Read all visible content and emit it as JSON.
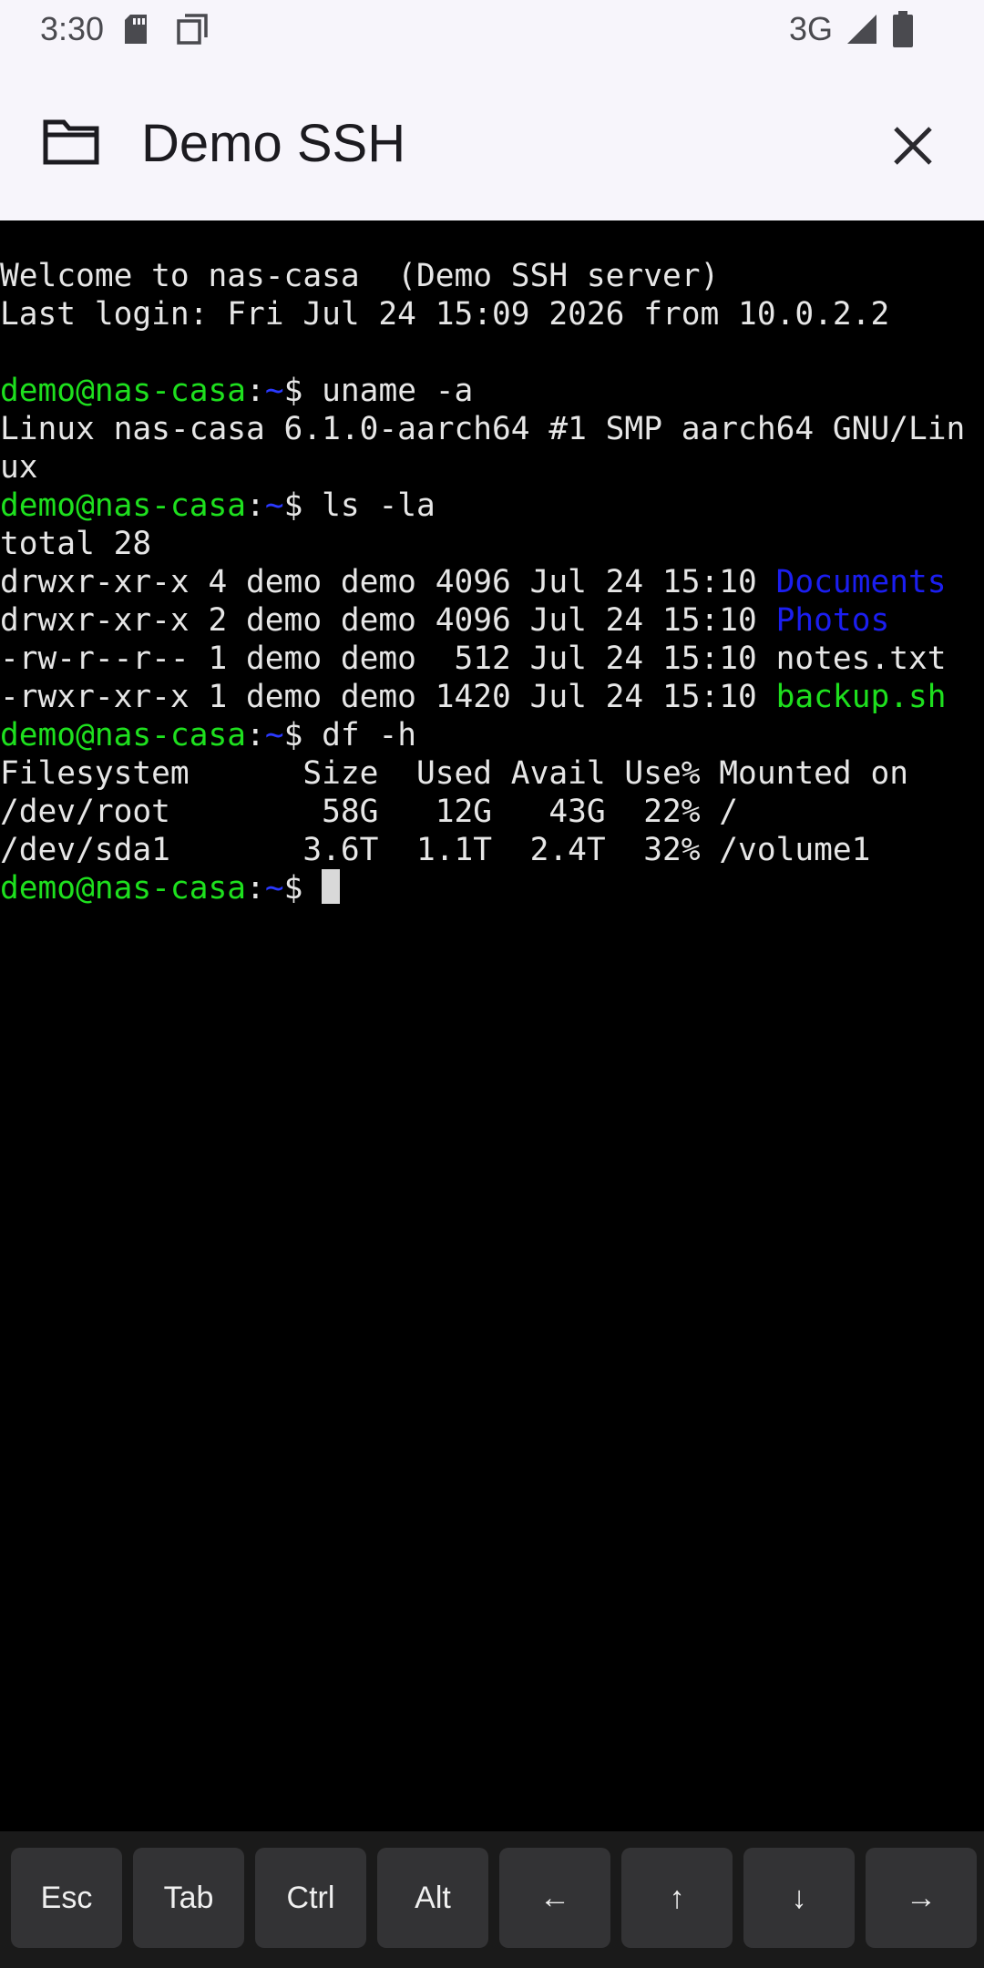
{
  "status_bar": {
    "time": "3:30",
    "network": "3G",
    "icons": [
      "sd-card-icon",
      "pages-icon",
      "signal-icon",
      "battery-icon"
    ]
  },
  "app_bar": {
    "title": "Demo SSH",
    "left_icon": "folder-icon",
    "right_icon": "close-icon"
  },
  "terminal": {
    "lines": [
      [
        {
          "t": "Welcome to nas-casa  (Demo SSH server)",
          "c": "white"
        }
      ],
      [
        {
          "t": "Last login: Fri Jul 24 15:09 2026 from 10.0.2.2",
          "c": "white"
        }
      ],
      [
        {
          "t": "",
          "c": "white"
        }
      ],
      [
        {
          "t": "demo@nas-casa",
          "c": "green"
        },
        {
          "t": ":",
          "c": "white"
        },
        {
          "t": "~",
          "c": "prompt-blue"
        },
        {
          "t": "$ uname -a",
          "c": "white"
        }
      ],
      [
        {
          "t": "Linux nas-casa 6.1.0-aarch64 #1 SMP aarch64 GNU/Lin",
          "c": "white"
        }
      ],
      [
        {
          "t": "ux",
          "c": "white"
        }
      ],
      [
        {
          "t": "demo@nas-casa",
          "c": "green"
        },
        {
          "t": ":",
          "c": "white"
        },
        {
          "t": "~",
          "c": "prompt-blue"
        },
        {
          "t": "$ ls -la",
          "c": "white"
        }
      ],
      [
        {
          "t": "total 28",
          "c": "white"
        }
      ],
      [
        {
          "t": "drwxr-xr-x 4 demo demo 4096 Jul 24 15:10 ",
          "c": "white"
        },
        {
          "t": "Documents",
          "c": "blue"
        }
      ],
      [
        {
          "t": "drwxr-xr-x 2 demo demo 4096 Jul 24 15:10 ",
          "c": "white"
        },
        {
          "t": "Photos",
          "c": "blue"
        }
      ],
      [
        {
          "t": "-rw-r--r-- 1 demo demo  512 Jul 24 15:10 notes.txt",
          "c": "white"
        }
      ],
      [
        {
          "t": "-rwxr-xr-x 1 demo demo 1420 Jul 24 15:10 ",
          "c": "white"
        },
        {
          "t": "backup.sh",
          "c": "green"
        }
      ],
      [
        {
          "t": "demo@nas-casa",
          "c": "green"
        },
        {
          "t": ":",
          "c": "white"
        },
        {
          "t": "~",
          "c": "prompt-blue"
        },
        {
          "t": "$ df -h",
          "c": "white"
        }
      ],
      [
        {
          "t": "Filesystem      Size  Used Avail Use% Mounted on",
          "c": "white"
        }
      ],
      [
        {
          "t": "/dev/root        58G   12G   43G  22% /",
          "c": "white"
        }
      ],
      [
        {
          "t": "/dev/sda1       3.6T  1.1T  2.4T  32% /volume1",
          "c": "white"
        }
      ],
      [
        {
          "t": "demo@nas-casa",
          "c": "green"
        },
        {
          "t": ":",
          "c": "white"
        },
        {
          "t": "~",
          "c": "prompt-blue"
        },
        {
          "t": "$ ",
          "c": "white"
        }
      ]
    ],
    "colors": {
      "background": "#000000",
      "text": "#e6e6e6",
      "green": "#1ee01e",
      "blue": "#1b1ef0"
    }
  },
  "extra_keys": {
    "keys": [
      "Esc",
      "Tab",
      "Ctrl",
      "Alt",
      "←",
      "↑",
      "↓",
      "→"
    ]
  }
}
